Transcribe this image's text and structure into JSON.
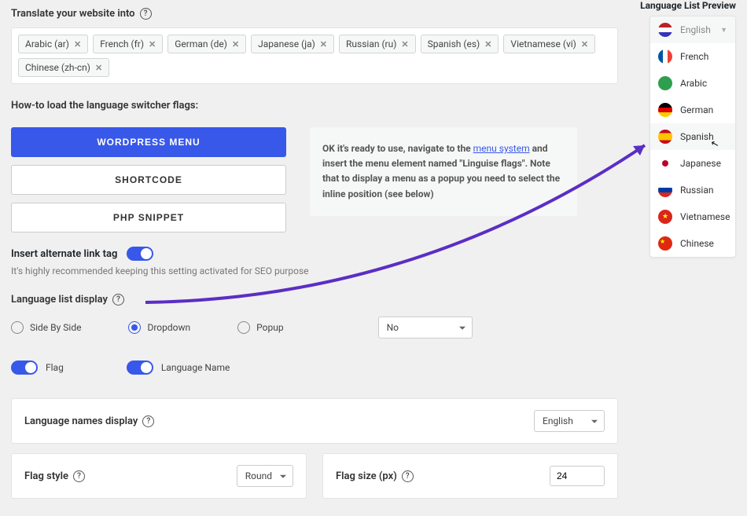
{
  "translate": {
    "label": "Translate your website into",
    "chips": [
      "Arabic (ar)",
      "French (fr)",
      "German (de)",
      "Japanese (ja)",
      "Russian (ru)",
      "Spanish (es)",
      "Vietnamese (vi)",
      "Chinese (zh-cn)"
    ]
  },
  "howto": {
    "label": "How-to load the language switcher flags:",
    "buttons": {
      "wordpress": "WORDPRESS MENU",
      "shortcode": "SHORTCODE",
      "php": "PHP SNIPPET"
    },
    "info_strong": "OK it's ready to use, navigate to the ",
    "info_link": "menu system",
    "info_after": " and insert the menu element named \"Linguise flags\". Note that to display a menu as a popup you need to select the inline position (see below)"
  },
  "alternate": {
    "label": "Insert alternate link tag",
    "hint": "It's highly recommended keeping this setting activated for SEO purpose"
  },
  "list_display": {
    "label": "Language list display",
    "options": {
      "side": "Side By Side",
      "dropdown": "Dropdown",
      "popup": "Popup"
    },
    "select_value": "No"
  },
  "toggles": {
    "flag": "Flag",
    "lang_name": "Language Name"
  },
  "names_display": {
    "label": "Language names display",
    "value": "English"
  },
  "flag_style": {
    "label": "Flag style",
    "value": "Round"
  },
  "flag_size": {
    "label": "Flag size (px)",
    "value": "24"
  },
  "preview": {
    "title": "Language List Preview",
    "items": [
      {
        "label": "English",
        "flag": "f-us",
        "header": true
      },
      {
        "label": "French",
        "flag": "f-fr"
      },
      {
        "label": "Arabic",
        "flag": "f-ar"
      },
      {
        "label": "German",
        "flag": "f-de"
      },
      {
        "label": "Spanish",
        "flag": "f-es",
        "hover": true
      },
      {
        "label": "Japanese",
        "flag": "f-jp"
      },
      {
        "label": "Russian",
        "flag": "f-ru"
      },
      {
        "label": "Vietnamese",
        "flag": "f-vn"
      },
      {
        "label": "Chinese",
        "flag": "f-cn"
      }
    ]
  }
}
